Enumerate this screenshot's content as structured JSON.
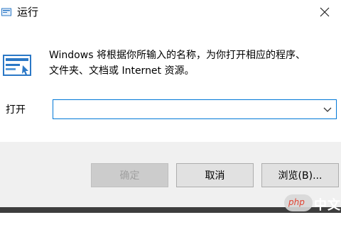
{
  "window": {
    "title": "运行",
    "close_icon": "close-icon"
  },
  "description": {
    "line1": "Windows 将根据你所输入的名称，为你打开相应的程序、",
    "line2": "文件夹、文档或 Internet 资源。"
  },
  "open_field": {
    "label": "打开",
    "value": "",
    "dropdown_icon": "chevron-down-icon"
  },
  "buttons": {
    "ok_label": "确定",
    "cancel_label": "取消",
    "browse_label": "浏览(B)..."
  },
  "watermark": {
    "logo_text": "php",
    "text": "中文网"
  },
  "colors": {
    "accent": "#0078d7",
    "footer_bg": "#f0f0f0",
    "button_bg": "#e1e1e1"
  }
}
